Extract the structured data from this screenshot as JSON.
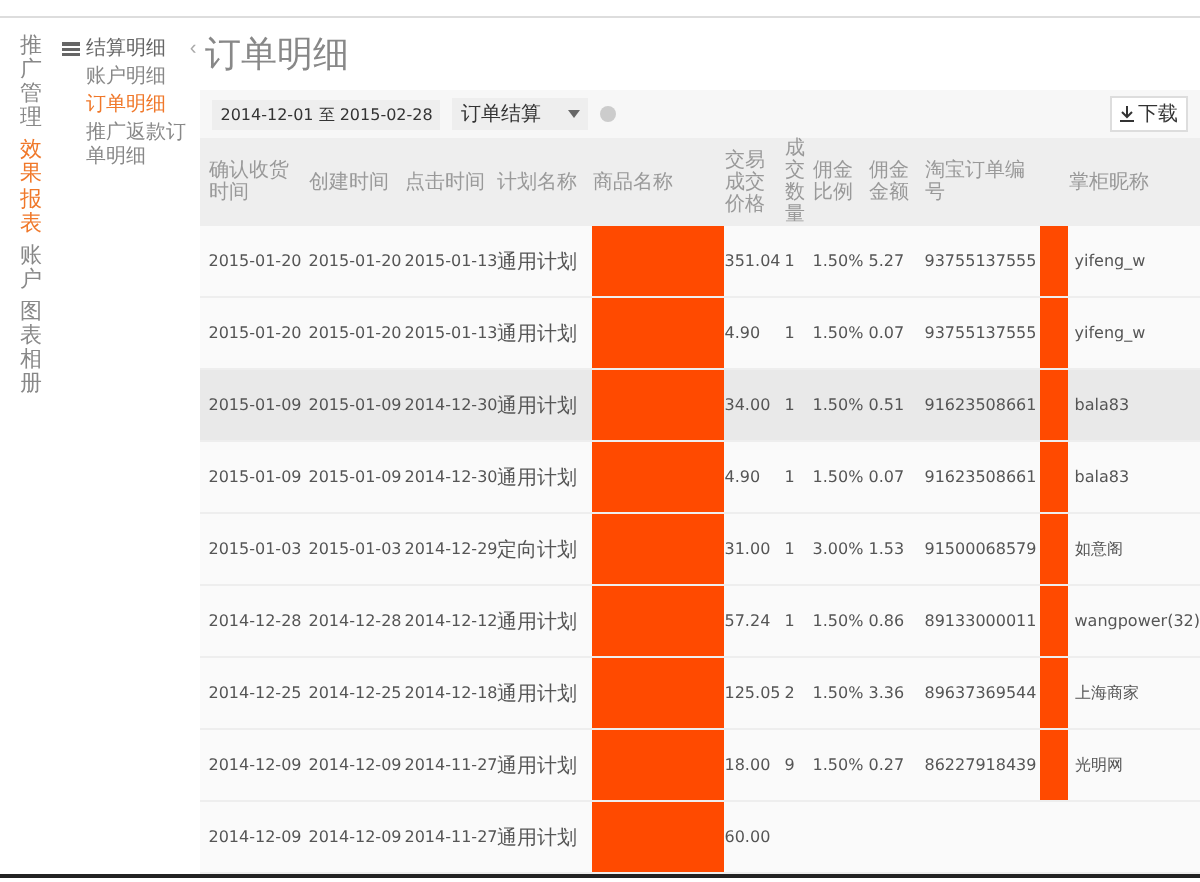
{
  "nav": [
    {
      "label": "推广管理",
      "selected": false
    },
    {
      "label": "效果报表",
      "selected": true
    },
    {
      "label": "账户",
      "selected": false
    },
    {
      "label": "图表相册",
      "selected": false
    }
  ],
  "subnav": {
    "title": "结算明细",
    "collapse": "‹",
    "items": [
      {
        "label": "账户明细",
        "selected": false
      },
      {
        "label": "订单明细",
        "selected": true
      },
      {
        "label": "推广返款订单明细",
        "selected": false
      }
    ]
  },
  "page_title": "订单明细",
  "toolbar": {
    "date_range": "2014-12-01 至 2015-02-28",
    "status_select": "订单结算",
    "download": "下载"
  },
  "table": {
    "columns": [
      "确认收货时间",
      "创建时间",
      "点击时间",
      "计划名称",
      "商品名称",
      "交易成交价格",
      "成交数量",
      "佣金比例",
      "佣金金额",
      "淘宝订单编号",
      "掌柜昵称"
    ],
    "rows": [
      {
        "selected": false,
        "cells": [
          "2015-01-20",
          "2015-01-20",
          "2015-01-13",
          "通用计划",
          "",
          "351.04",
          "1",
          "1.50%",
          "5.27",
          "93755137555",
          "yifeng_w"
        ]
      },
      {
        "selected": false,
        "cells": [
          "2015-01-20",
          "2015-01-20",
          "2015-01-13",
          "通用计划",
          "",
          "4.90",
          "1",
          "1.50%",
          "0.07",
          "93755137555",
          "yifeng_w"
        ]
      },
      {
        "selected": true,
        "cells": [
          "2015-01-09",
          "2015-01-09",
          "2014-12-30",
          "通用计划",
          "",
          "34.00",
          "1",
          "1.50%",
          "0.51",
          "91623508661",
          "bala83"
        ]
      },
      {
        "selected": false,
        "cells": [
          "2015-01-09",
          "2015-01-09",
          "2014-12-30",
          "通用计划",
          "",
          "4.90",
          "1",
          "1.50%",
          "0.07",
          "91623508661",
          "bala83"
        ]
      },
      {
        "selected": false,
        "cells": [
          "2015-01-03",
          "2015-01-03",
          "2014-12-29",
          "定向计划",
          "",
          "31.00",
          "1",
          "3.00%",
          "1.53",
          "91500068579",
          "如意阁"
        ]
      },
      {
        "selected": false,
        "cells": [
          "2014-12-28",
          "2014-12-28",
          "2014-12-12",
          "通用计划",
          "",
          "57.24",
          "1",
          "1.50%",
          "0.86",
          "89133000011",
          "wangpower(32)"
        ]
      },
      {
        "selected": false,
        "cells": [
          "2014-12-25",
          "2014-12-25",
          "2014-12-18",
          "通用计划",
          "",
          "125.05",
          "2",
          "1.50%",
          "3.36",
          "89637369544",
          "上海商家"
        ]
      },
      {
        "selected": false,
        "cells": [
          "2014-12-09",
          "2014-12-09",
          "2014-11-27",
          "通用计划",
          "",
          "18.00",
          "9",
          "1.50%",
          "0.27",
          "86227918439",
          "光明网"
        ]
      },
      {
        "selected": false,
        "cells": [
          "2014-12-09",
          "2014-12-09",
          "2014-11-27",
          "通用计划",
          "",
          "60.00"
        ]
      }
    ]
  }
}
